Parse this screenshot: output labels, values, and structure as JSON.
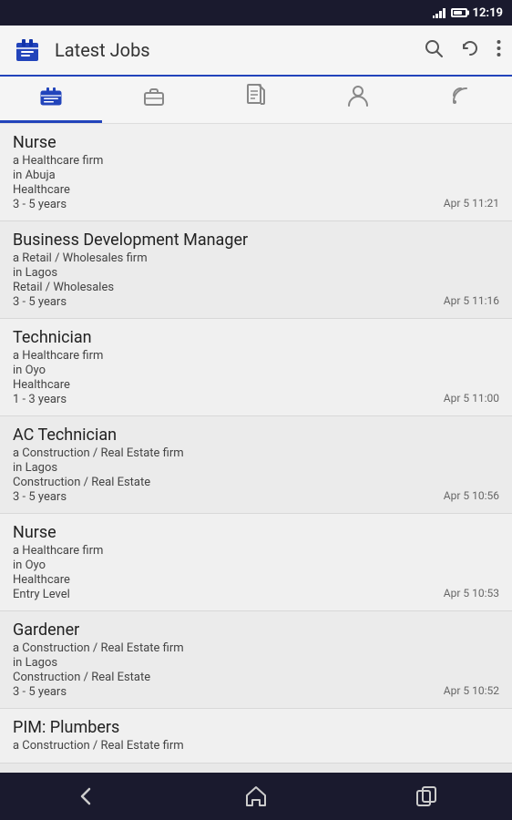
{
  "statusBar": {
    "time": "12:19",
    "batteryPercent": 70
  },
  "appBar": {
    "title": "Latest Jobs",
    "searchLabel": "search",
    "refreshLabel": "refresh",
    "moreLabel": "more"
  },
  "tabs": [
    {
      "id": "jobs",
      "icon": "jobs-icon",
      "active": true
    },
    {
      "id": "briefcase",
      "icon": "briefcase-icon",
      "active": false
    },
    {
      "id": "document",
      "icon": "document-icon",
      "active": false
    },
    {
      "id": "profile",
      "icon": "profile-icon",
      "active": false
    },
    {
      "id": "rss",
      "icon": "rss-icon",
      "active": false
    }
  ],
  "jobs": [
    {
      "title": "Nurse",
      "company": "a Healthcare firm",
      "location": "in Abuja",
      "category": "Healthcare",
      "experience": "3 - 5 years",
      "date": "Apr 5",
      "time": "11:21"
    },
    {
      "title": "Business Development Manager",
      "company": "a Retail / Wholesales firm",
      "location": "in Lagos",
      "category": "Retail / Wholesales",
      "experience": "3 - 5 years",
      "date": "Apr 5",
      "time": "11:16"
    },
    {
      "title": "Technician",
      "company": "a Healthcare firm",
      "location": "in Oyo",
      "category": "Healthcare",
      "experience": "1 - 3 years",
      "date": "Apr 5",
      "time": "11:00"
    },
    {
      "title": "AC Technician",
      "company": "a Construction / Real Estate firm",
      "location": "in Lagos",
      "category": "Construction / Real Estate",
      "experience": "3 - 5 years",
      "date": "Apr 5",
      "time": "10:56"
    },
    {
      "title": "Nurse",
      "company": "a Healthcare firm",
      "location": "in Oyo",
      "category": "Healthcare",
      "experience": "Entry Level",
      "date": "Apr 5",
      "time": "10:53"
    },
    {
      "title": "Gardener",
      "company": "a Construction / Real Estate firm",
      "location": "in Lagos",
      "category": "Construction / Real Estate",
      "experience": "3 - 5 years",
      "date": "Apr 5",
      "time": "10:52"
    },
    {
      "title": "PIM: Plumbers",
      "company": "a Construction / Real Estate firm",
      "location": "",
      "category": "",
      "experience": "",
      "date": "",
      "time": ""
    }
  ],
  "bottomNav": {
    "back": "back",
    "home": "home",
    "recent": "recent"
  }
}
